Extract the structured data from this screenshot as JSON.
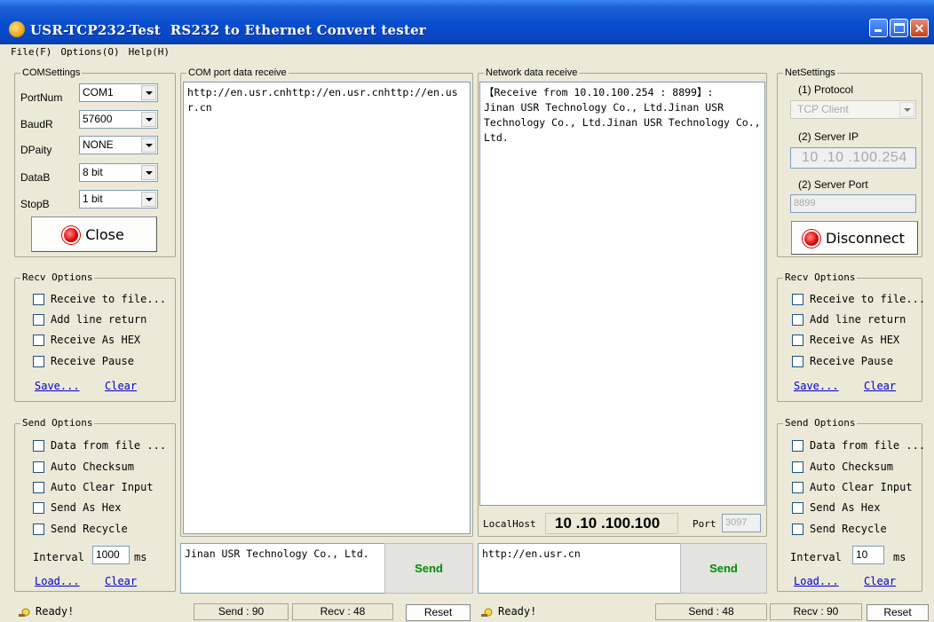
{
  "window": {
    "title": "USR-TCP232-Test  RS232 to Ethernet Convert tester"
  },
  "menu": [
    "File(F)",
    "Options(O)",
    "Help(H)"
  ],
  "com_settings": {
    "title": "COMSettings",
    "fields": [
      {
        "label": "PortNum",
        "value": "COM1"
      },
      {
        "label": "BaudR",
        "value": "57600"
      },
      {
        "label": "DPaity",
        "value": "NONE"
      },
      {
        "label": "DataB",
        "value": "8 bit"
      },
      {
        "label": "StopB",
        "value": "1 bit"
      }
    ],
    "button": "Close"
  },
  "left_recv": {
    "title": "Recv Options",
    "options": [
      "Receive to file...",
      "Add line return",
      "Receive As HEX",
      "Receive Pause"
    ],
    "save": "Save...",
    "clear": "Clear"
  },
  "left_send": {
    "title": "Send Options",
    "options": [
      "Data from file ...",
      "Auto Checksum",
      "Auto Clear Input",
      "Send As Hex",
      "Send Recycle"
    ],
    "interval_label": "Interval",
    "interval_value": "1000",
    "interval_unit": "ms",
    "load": "Load...",
    "clear": "Clear"
  },
  "com_receive": {
    "title": "COM port data receive",
    "text": "http://en.usr.cnhttp://en.usr.cnhttp://en.usr.cn"
  },
  "com_send": {
    "text": "Jinan USR Technology Co., Ltd.",
    "button": "Send"
  },
  "net_receive": {
    "title": "Network data receive",
    "text": "【Receive from 10.10.100.254 : 8899】:\nJinan USR Technology Co., Ltd.Jinan USR Technology Co., Ltd.Jinan USR Technology Co., Ltd."
  },
  "localhost": {
    "label": "LocalHost",
    "ip": "10 .10 .100.100",
    "port_label": "Port",
    "port_value": "3097"
  },
  "net_send": {
    "text": "http://en.usr.cn",
    "button": "Send"
  },
  "net_settings": {
    "title": "NetSettings",
    "protocol_label": "(1) Protocol",
    "protocol_value": "TCP Client",
    "server_ip_label": "(2) Server IP",
    "server_ip": [
      "10",
      "10",
      "100",
      "254"
    ],
    "server_port_label": "(2) Server Port",
    "server_port": "8899",
    "button": "Disconnect"
  },
  "right_recv": {
    "title": "Recv Options",
    "options": [
      "Receive to file...",
      "Add line return",
      "Receive As HEX",
      "Receive Pause"
    ],
    "save": "Save...",
    "clear": "Clear"
  },
  "right_send": {
    "title": "Send Options",
    "options": [
      "Data from file ...",
      "Auto Checksum",
      "Auto Clear Input",
      "Send As Hex",
      "Send Recycle"
    ],
    "interval_label": "Interval",
    "interval_value": "10",
    "interval_unit": "ms",
    "load": "Load...",
    "clear": "Clear"
  },
  "status": {
    "left_ready": "Ready!",
    "com_send": "Send : 90",
    "com_recv": "Recv : 48",
    "com_reset": "Reset",
    "right_ready": "Ready!",
    "net_send": "Send : 48",
    "net_recv": "Recv : 90",
    "net_reset": "Reset"
  },
  "colors": {
    "title_bar": "#0a4fcf",
    "send_button_text": "#008c00",
    "link": "#0000cc",
    "led": "#e00000"
  }
}
